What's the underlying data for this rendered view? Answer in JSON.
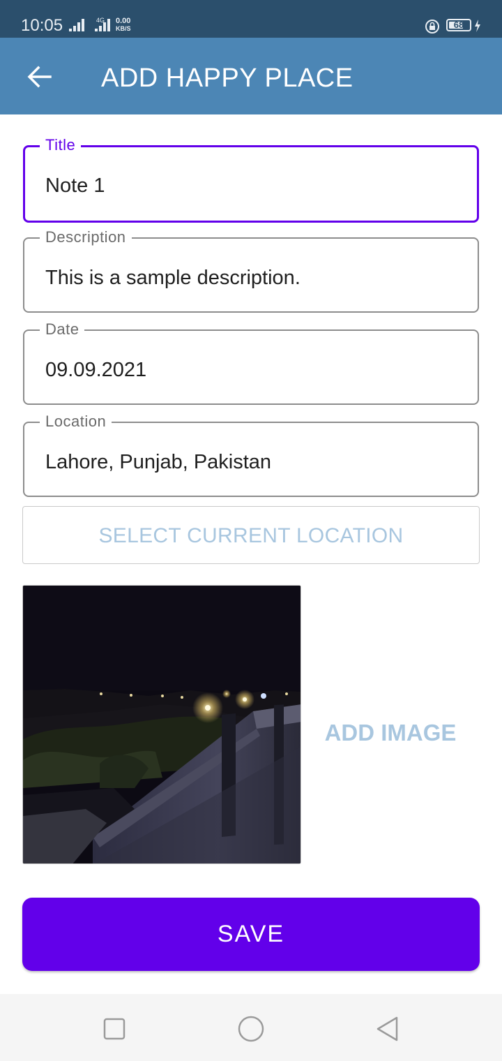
{
  "status_bar": {
    "time": "10:05",
    "network": "4G",
    "speed_value": "0.00",
    "speed_unit": "KB/S",
    "battery": "68"
  },
  "app_bar": {
    "back_icon": "arrow-back-icon",
    "title": "ADD HAPPY PLACE",
    "background_color": "#4c86b5"
  },
  "form": {
    "title": {
      "label": "Title",
      "value": "Note 1",
      "focused": true
    },
    "description": {
      "label": "Description",
      "value": "This is a sample description."
    },
    "date": {
      "label": "Date",
      "value": "09.09.2021"
    },
    "location": {
      "label": "Location",
      "value": "Lahore, Punjab, Pakistan"
    }
  },
  "select_location_button": "SELECT CURRENT LOCATION",
  "add_image_button": "ADD IMAGE",
  "save_button": "SAVE",
  "colors": {
    "accent": "#6200ea",
    "muted_button_text": "#a8c6df"
  },
  "nav_bar": {
    "icons": [
      "recent-apps-icon",
      "home-icon",
      "back-triangle-icon"
    ]
  }
}
